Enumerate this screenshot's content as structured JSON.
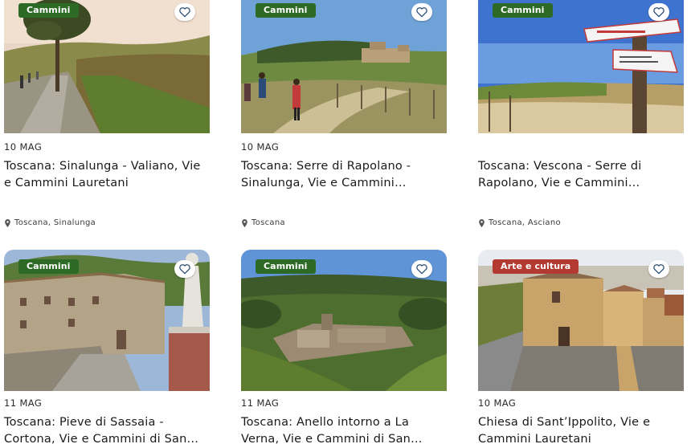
{
  "icons": {
    "favorite": "heart-outline-icon",
    "location": "map-pin-icon"
  },
  "colors": {
    "badge_cammini": "#2d6a25",
    "badge_arte": "#b23a31",
    "heart": "#2a4c74"
  },
  "cards": [
    {
      "badge": "Cammini",
      "date": "10 MAG",
      "title": "Toscana: Sinalunga - Valiano, Vie e Cammini Lauretani",
      "location": "Toscana, Sinalunga"
    },
    {
      "badge": "Cammini",
      "date": "10 MAG",
      "title": "Toscana: Serre di Rapolano - Sinalunga, Vie e Cammini Lauretani",
      "location": "Toscana"
    },
    {
      "badge": "Cammini",
      "date": "",
      "title": "Toscana: Vescona - Serre di Rapolano, Vie e Cammini Lauretani",
      "location": "Toscana, Asciano"
    },
    {
      "badge": "Cammini",
      "date": "11 MAG",
      "title": "Toscana: Pieve di Sassaia - Cortona, Vie e Cammini di San Francesco"
    },
    {
      "badge": "Cammini",
      "date": "11 MAG",
      "title": "Toscana: Anello intorno a La Verna, Vie e Cammini di San Francesco"
    },
    {
      "badge": "Arte e cultura",
      "date": "10 MAG",
      "title": "Chiesa di Sant’Ippolito, Vie e Cammini Lauretani"
    }
  ]
}
